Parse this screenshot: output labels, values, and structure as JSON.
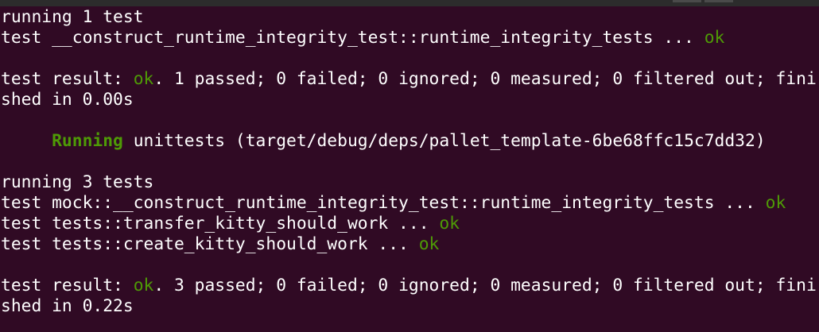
{
  "terminal": {
    "ok_color": "#4e9a06",
    "background": "#300a24",
    "lines": [
      {
        "t1": "running 1 test"
      },
      {
        "t1": "test __construct_runtime_integrity_test::runtime_integrity_tests ... ",
        "ok": "ok"
      },
      {
        "t1": ""
      },
      {
        "t1": "test result: ",
        "ok": "ok",
        "t2": ". 1 passed; 0 failed; 0 ignored; 0 measured; 0 filtered out; fini"
      },
      {
        "t1": "shed in 0.00s"
      },
      {
        "t1": ""
      },
      {
        "indent": "     ",
        "running": "Running",
        "t1": " unittests (target/debug/deps/pallet_template-6be68ffc15c7dd32)"
      },
      {
        "t1": ""
      },
      {
        "t1": "running 3 tests"
      },
      {
        "t1": "test mock::__construct_runtime_integrity_test::runtime_integrity_tests ... ",
        "ok": "ok"
      },
      {
        "t1": "test tests::transfer_kitty_should_work ... ",
        "ok": "ok"
      },
      {
        "t1": "test tests::create_kitty_should_work ... ",
        "ok": "ok"
      },
      {
        "t1": ""
      },
      {
        "t1": "test result: ",
        "ok": "ok",
        "t2": ". 3 passed; 0 failed; 0 ignored; 0 measured; 0 filtered out; fini"
      },
      {
        "t1": "shed in 0.22s"
      }
    ]
  }
}
